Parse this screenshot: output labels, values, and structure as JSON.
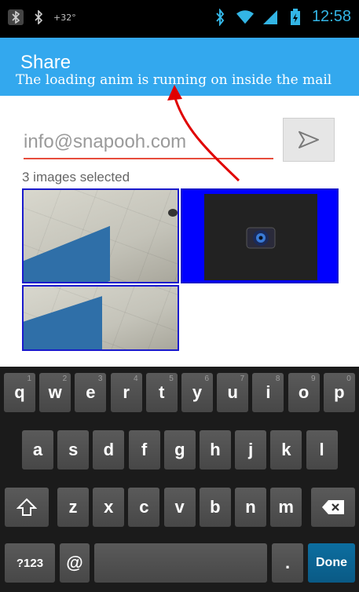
{
  "status_bar": {
    "temperature": "+32°",
    "time": "12:58",
    "left_box_icon": "bluetooth-icon",
    "bt_icon": "bluetooth-icon"
  },
  "action_bar": {
    "title": "Share",
    "annotation": "The loading anim is running on inside the mail",
    "color": "#33a8ee"
  },
  "email": {
    "value": "info@snapooh.com",
    "underline_color": "#e74c3c",
    "send_icon": "send-icon"
  },
  "images": {
    "label": "3 images selected",
    "count": 3
  },
  "keyboard": {
    "row1": [
      {
        "k": "q",
        "n": "1"
      },
      {
        "k": "w",
        "n": "2"
      },
      {
        "k": "e",
        "n": "3"
      },
      {
        "k": "r",
        "n": "4"
      },
      {
        "k": "t",
        "n": "5"
      },
      {
        "k": "y",
        "n": "6"
      },
      {
        "k": "u",
        "n": "7"
      },
      {
        "k": "i",
        "n": "8"
      },
      {
        "k": "o",
        "n": "9"
      },
      {
        "k": "p",
        "n": "0"
      }
    ],
    "row2": [
      "a",
      "s",
      "d",
      "f",
      "g",
      "h",
      "j",
      "k",
      "l"
    ],
    "row3": [
      "z",
      "x",
      "c",
      "v",
      "b",
      "n",
      "m"
    ],
    "symbols": "?123",
    "at": "@",
    "dot": ".",
    "done": "Done"
  }
}
